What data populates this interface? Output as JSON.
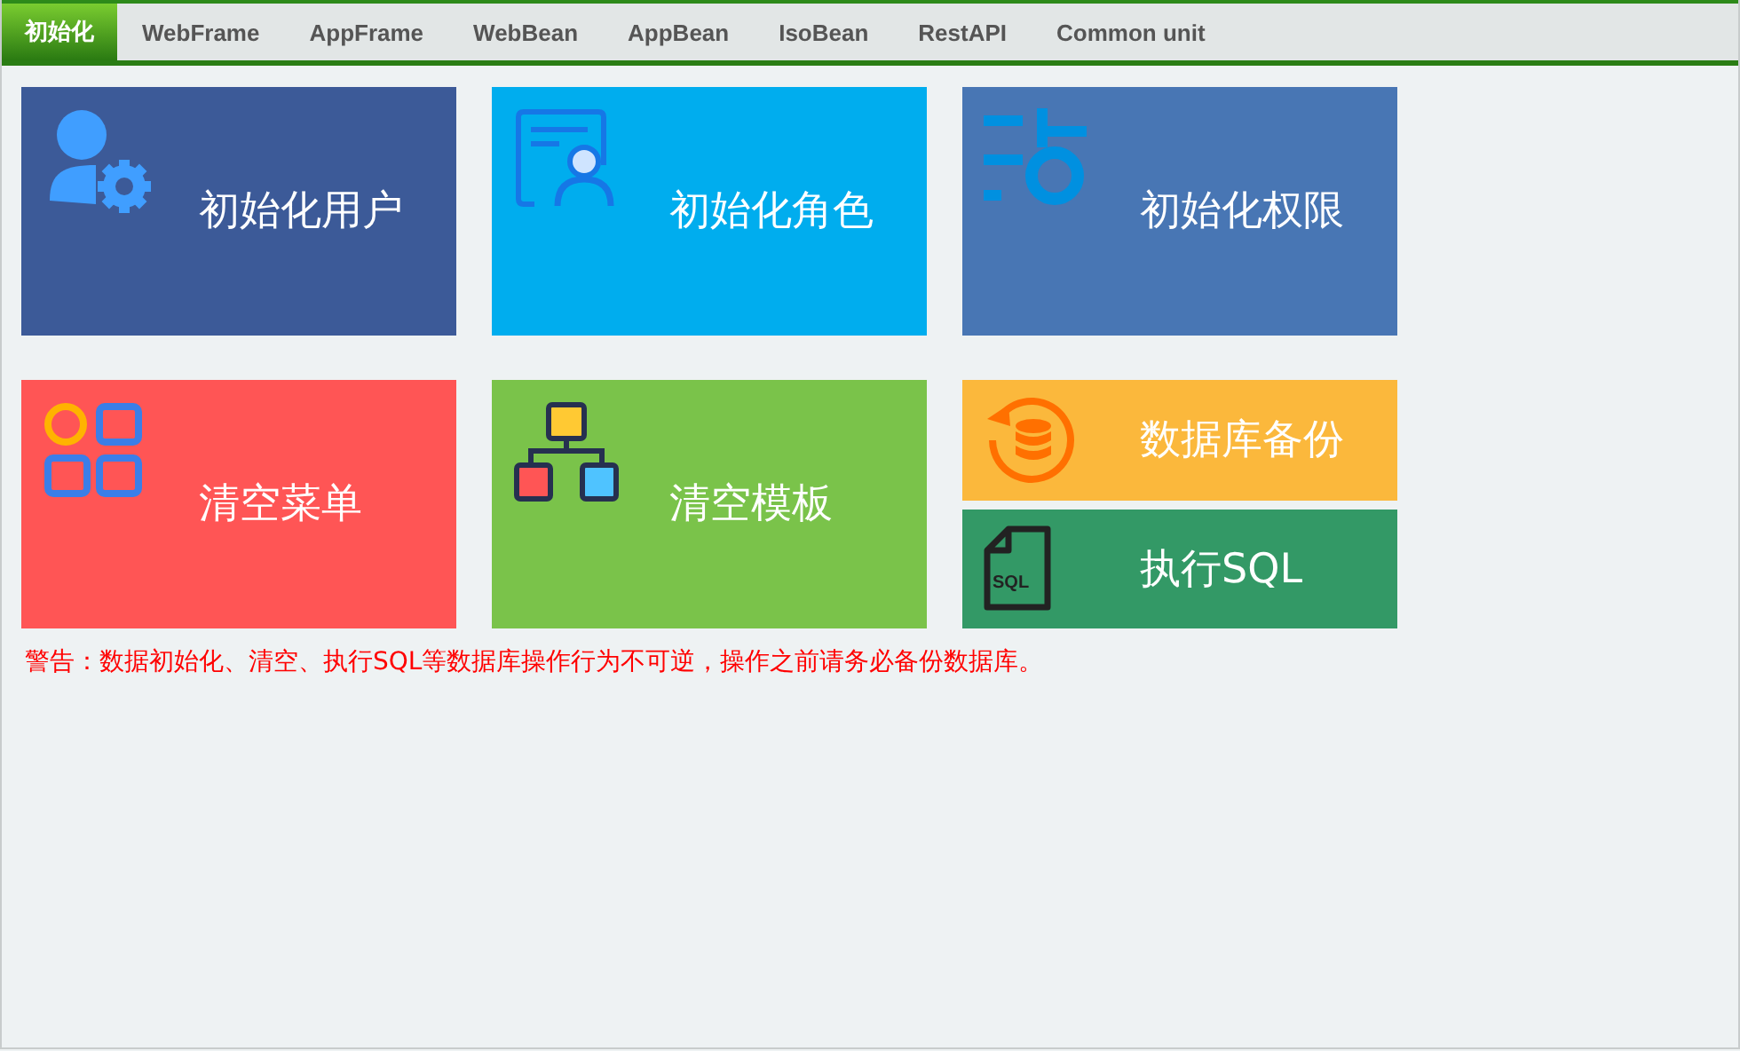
{
  "tabs": [
    {
      "label": "初始化",
      "selected": true
    },
    {
      "label": "WebFrame",
      "selected": false
    },
    {
      "label": "AppFrame",
      "selected": false
    },
    {
      "label": "WebBean",
      "selected": false
    },
    {
      "label": "AppBean",
      "selected": false
    },
    {
      "label": "IsoBean",
      "selected": false
    },
    {
      "label": "RestAPI",
      "selected": false
    },
    {
      "label": "Common unit",
      "selected": false
    }
  ],
  "rows": [
    [
      {
        "label": "初始化用户",
        "color": "#3c5a98"
      },
      {
        "label": "初始化角色",
        "color": "#00adee"
      },
      {
        "label": "初始化权限",
        "color": "#4876b4"
      }
    ],
    [
      {
        "label": "清空菜单",
        "color": "#ff5555"
      },
      {
        "label": "清空模板",
        "color": "#7ac34a"
      },
      {
        "stack": [
          {
            "label": "数据库备份",
            "color": "#fbb83c"
          },
          {
            "label": "执行SQL",
            "color": "#339966",
            "icon_label": "SQL"
          }
        ]
      }
    ]
  ],
  "warning": "警告：数据初始化、清空、执行SQL等数据库操作行为不可逆，操作之前请务必备份数据库。"
}
